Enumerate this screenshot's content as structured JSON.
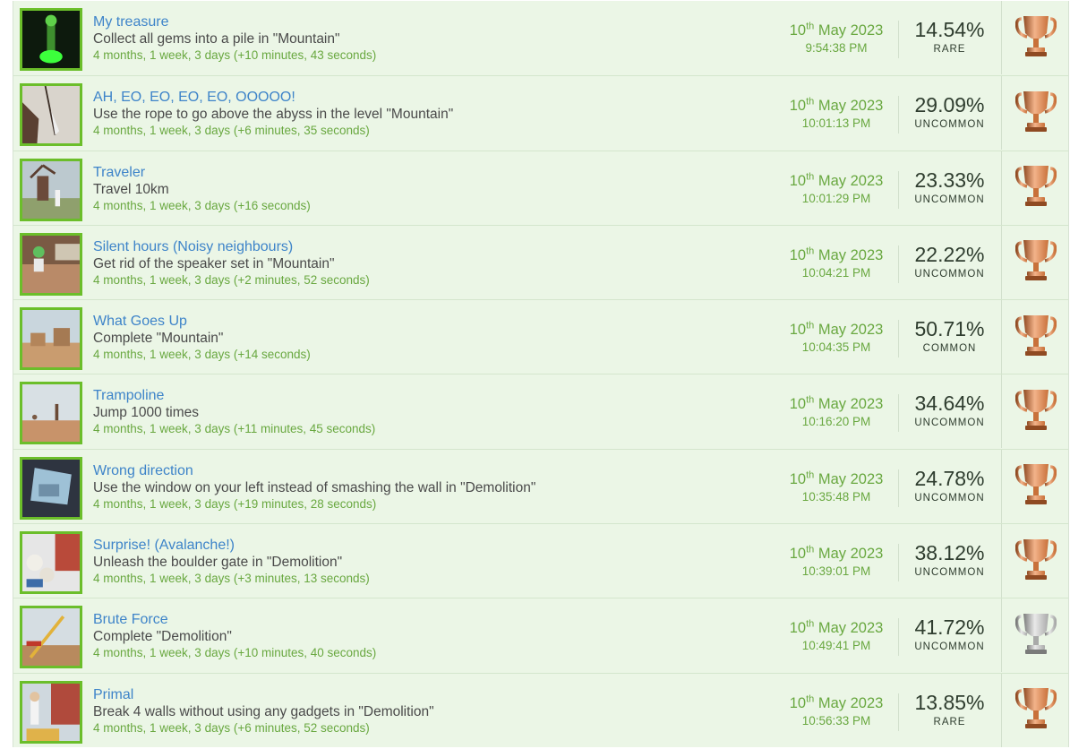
{
  "colors": {
    "row_bg": "#ebf6e6",
    "title": "#3e84c9",
    "green_text": "#69a840",
    "thumb_border": "#6bbe2a",
    "bronze": "#c8713a",
    "silver": "#a9aaa9"
  },
  "achievements": [
    {
      "title": "My treasure",
      "desc": "Collect all gems into a pile in \"Mountain\"",
      "elapsed": "4 months, 1 week, 3 days (+10 minutes, 43 seconds)",
      "day": "10",
      "suffix": "th",
      "month_year": " May 2023",
      "time": "9:54:38 PM",
      "percent": "14.54%",
      "rarity": "RARE",
      "trophy": "bronze-trophy-icon",
      "image": "green glowing gem statue"
    },
    {
      "title": "AH, EO, EO, EO, EO, OOOOO!",
      "desc": "Use the rope to go above the abyss in the level \"Mountain\"",
      "elapsed": "4 months, 1 week, 3 days (+6 minutes, 35 seconds)",
      "day": "10",
      "suffix": "th",
      "month_year": " May 2023",
      "time": "10:01:13 PM",
      "percent": "29.09%",
      "rarity": "UNCOMMON",
      "trophy": "bronze-trophy-icon",
      "image": "character swinging on rope"
    },
    {
      "title": "Traveler",
      "desc": "Travel 10km",
      "elapsed": "4 months, 1 week, 3 days (+16 seconds)",
      "day": "10",
      "suffix": "th",
      "month_year": " May 2023",
      "time": "10:01:29 PM",
      "percent": "23.33%",
      "rarity": "UNCOMMON",
      "trophy": "bronze-trophy-icon",
      "image": "windmill and character"
    },
    {
      "title": "Silent hours (Noisy neighbours)",
      "desc": "Get rid of the speaker set in \"Mountain\"",
      "elapsed": "4 months, 1 week, 3 days (+2 minutes, 52 seconds)",
      "day": "10",
      "suffix": "th",
      "month_year": " May 2023",
      "time": "10:04:21 PM",
      "percent": "22.22%",
      "rarity": "UNCOMMON",
      "trophy": "bronze-trophy-icon",
      "image": "character on balcony"
    },
    {
      "title": "What Goes Up",
      "desc": "Complete \"Mountain\"",
      "elapsed": "4 months, 1 week, 3 days (+14 seconds)",
      "day": "10",
      "suffix": "th",
      "month_year": " May 2023",
      "time": "10:04:35 PM",
      "percent": "50.71%",
      "rarity": "COMMON",
      "trophy": "bronze-trophy-icon",
      "image": "desert village"
    },
    {
      "title": "Trampoline",
      "desc": "Jump 1000 times",
      "elapsed": "4 months, 1 week, 3 days (+11 minutes, 45 seconds)",
      "day": "10",
      "suffix": "th",
      "month_year": " May 2023",
      "time": "10:16:20 PM",
      "percent": "34.64%",
      "rarity": "UNCOMMON",
      "trophy": "bronze-trophy-icon",
      "image": "character jumping in desert"
    },
    {
      "title": "Wrong direction",
      "desc": "Use the window on your left instead of smashing the wall in \"Demolition\"",
      "elapsed": "4 months, 1 week, 3 days (+19 minutes, 28 seconds)",
      "day": "10",
      "suffix": "th",
      "month_year": " May 2023",
      "time": "10:35:48 PM",
      "percent": "24.78%",
      "rarity": "UNCOMMON",
      "trophy": "bronze-trophy-icon",
      "image": "view through broken window"
    },
    {
      "title": "Surprise! (Avalanche!)",
      "desc": "Unleash the boulder gate in \"Demolition\"",
      "elapsed": "4 months, 1 week, 3 days (+3 minutes, 13 seconds)",
      "day": "10",
      "suffix": "th",
      "month_year": " May 2023",
      "time": "10:39:01 PM",
      "percent": "38.12%",
      "rarity": "UNCOMMON",
      "trophy": "bronze-trophy-icon",
      "image": "boulders falling"
    },
    {
      "title": "Brute Force",
      "desc": "Complete \"Demolition\"",
      "elapsed": "4 months, 1 week, 3 days (+10 minutes, 40 seconds)",
      "day": "10",
      "suffix": "th",
      "month_year": " May 2023",
      "time": "10:49:41 PM",
      "percent": "41.72%",
      "rarity": "UNCOMMON",
      "trophy": "silver-trophy-icon",
      "image": "construction crane"
    },
    {
      "title": "Primal",
      "desc": "Break 4 walls without using any gadgets in \"Demolition\"",
      "elapsed": "4 months, 1 week, 3 days (+6 minutes, 52 seconds)",
      "day": "10",
      "suffix": "th",
      "month_year": " May 2023",
      "time": "10:56:33 PM",
      "percent": "13.85%",
      "rarity": "RARE",
      "trophy": "bronze-trophy-icon",
      "image": "character breaking wall"
    }
  ]
}
